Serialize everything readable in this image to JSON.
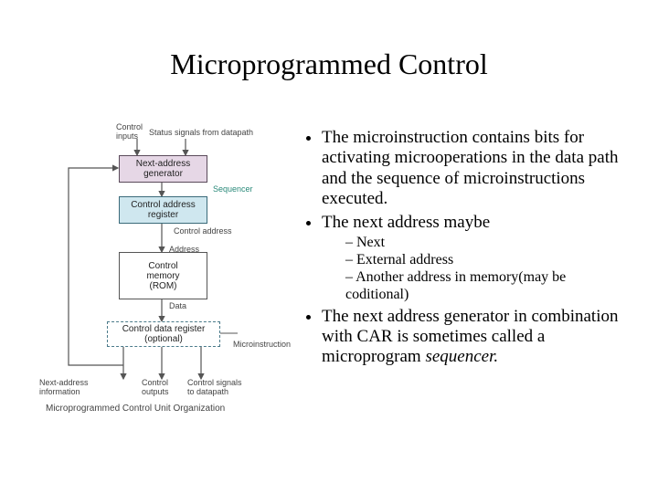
{
  "title": "Microprogrammed Control",
  "bullets": {
    "b1": "The microinstruction contains bits for activating microoperations in the data path and the sequence of microinstructions executed.",
    "b2": "The next address maybe",
    "b2_sub": {
      "s1": "Next",
      "s2": "External address",
      "s3": "Another address in memory(may be coditional)"
    },
    "b3_pre": "The next address generator in combination with CAR is sometimes called a microprogram ",
    "b3_em": "sequencer."
  },
  "diagram": {
    "top_labels": {
      "control_inputs": "Control\ninputs",
      "status_signals": "Status signals from datapath"
    },
    "boxes": {
      "nag": "Next-address\ngenerator",
      "car": "Control address\nregister",
      "rom": "Control\nmemory\n(ROM)",
      "cdr": "Control data register\n(optional)"
    },
    "side_labels": {
      "sequencer": "Sequencer",
      "control_address": "Control address",
      "address": "Address",
      "data": "Data",
      "microinstruction": "Microinstruction"
    },
    "bottom_labels": {
      "nai": "Next-address\ninformation",
      "co": "Control\noutputs",
      "cs": "Control signals\nto datapath"
    },
    "caption": "Microprogrammed Control Unit Organization"
  }
}
